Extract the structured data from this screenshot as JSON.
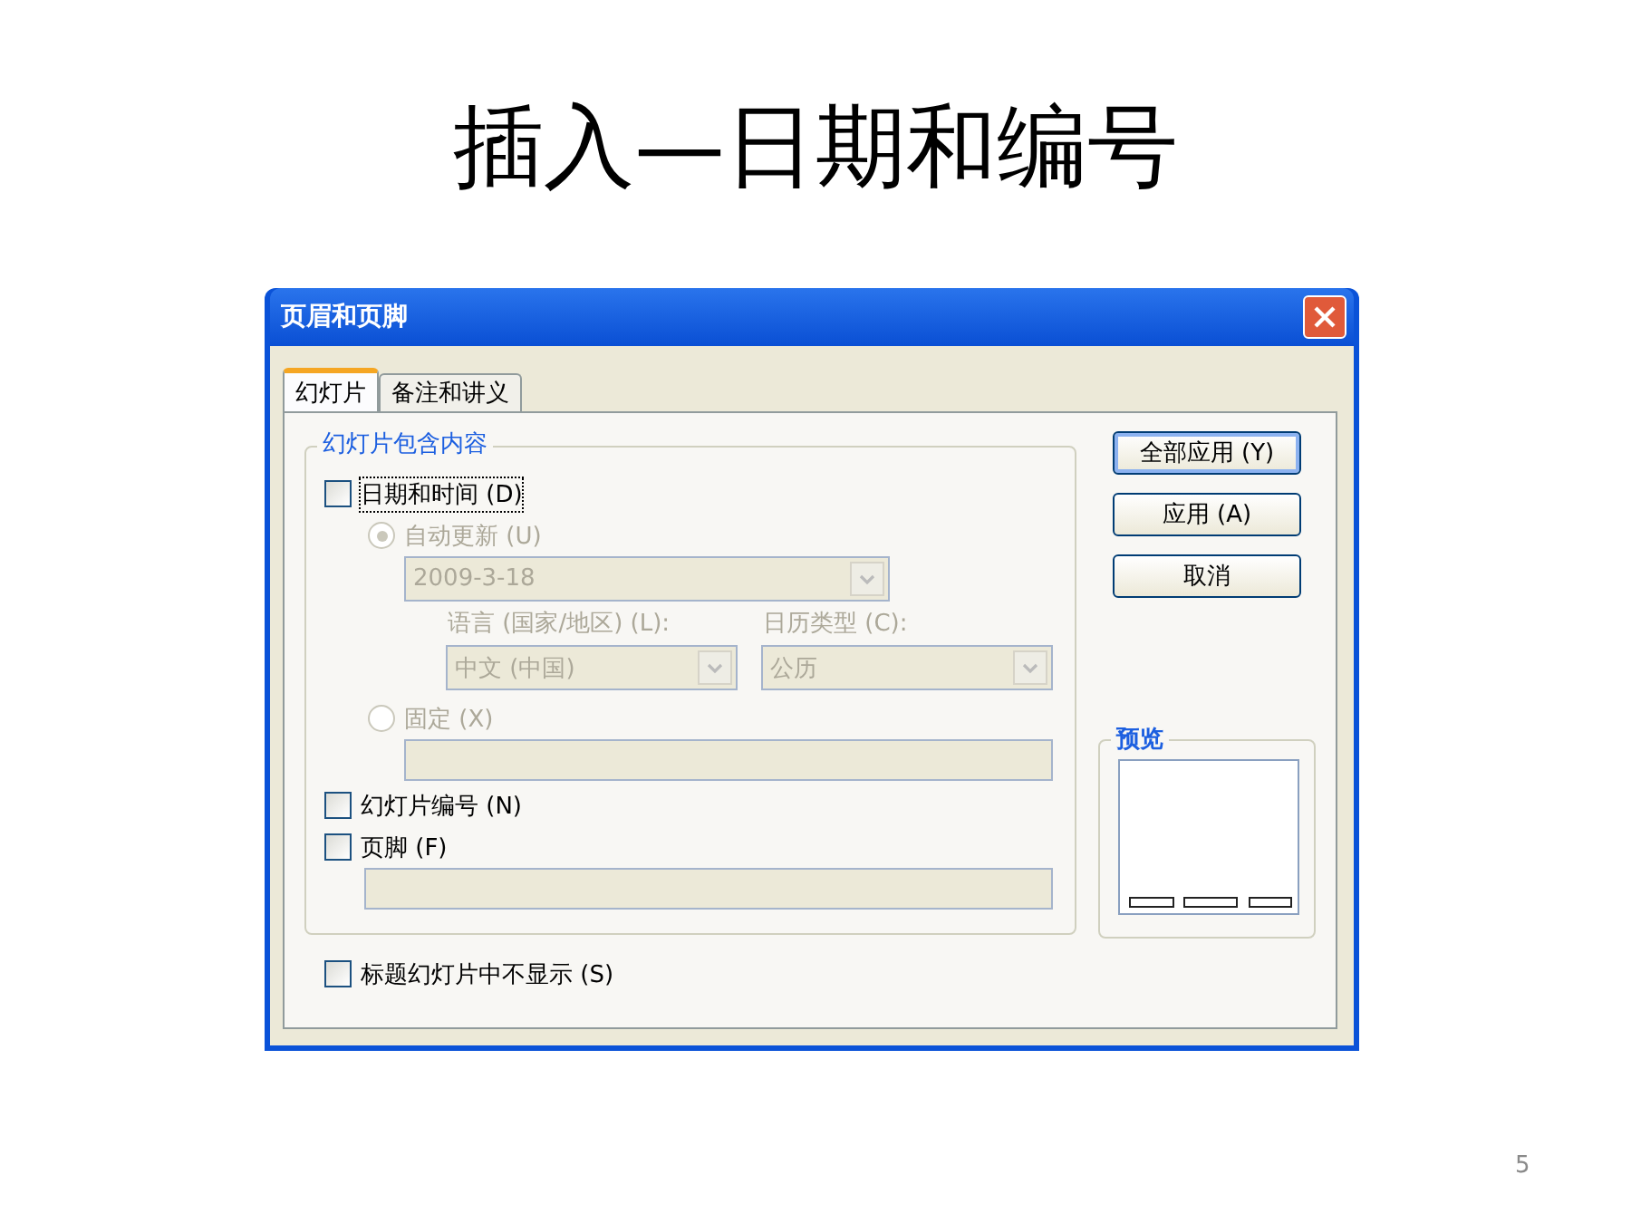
{
  "slide": {
    "title": "插入—日期和编号",
    "page_number": "5"
  },
  "dialog": {
    "title": "页眉和页脚",
    "tabs": [
      {
        "label": "幻灯片",
        "selected": true
      },
      {
        "label": "备注和讲义",
        "selected": false
      }
    ],
    "group": {
      "title": "幻灯片包含内容",
      "date_time": {
        "label": "日期和时间 (D)",
        "checked": false,
        "focused": true
      },
      "auto_update": {
        "label": "自动更新 (U)",
        "selected": true,
        "disabled": true
      },
      "date_select": {
        "value": "2009-3-18",
        "disabled": true
      },
      "language": {
        "label": "语言 (国家/地区) (L):",
        "value": "中文 (中国)",
        "disabled": true
      },
      "calendar": {
        "label": "日历类型 (C):",
        "value": "公历",
        "disabled": true
      },
      "fixed": {
        "label": "固定 (X)",
        "selected": false,
        "disabled": true
      },
      "fixed_field": {
        "disabled": true
      },
      "slide_number": {
        "label": "幻灯片编号 (N)",
        "checked": false
      },
      "footer": {
        "label": "页脚 (F)",
        "checked": false
      },
      "footer_field": {
        "disabled": true
      }
    },
    "hide_on_title": {
      "label": "标题幻灯片中不显示 (S)",
      "checked": false
    },
    "buttons": [
      {
        "label": "全部应用 (Y)",
        "default": true
      },
      {
        "label": "应用 (A)",
        "default": false
      },
      {
        "label": "取消",
        "default": false
      }
    ],
    "preview": {
      "title": "预览"
    }
  }
}
